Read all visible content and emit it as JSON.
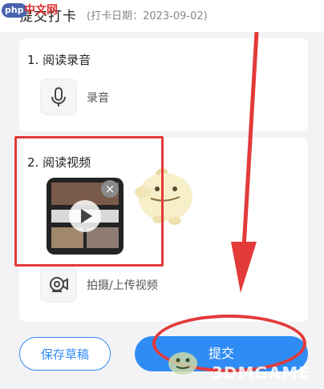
{
  "header": {
    "title": "提交打卡",
    "date_text": "(打卡日期：2023-09-02)"
  },
  "site_watermark": {
    "badge": "php",
    "cn_text": "中文网"
  },
  "audio_section": {
    "title": "1. 阅读录音",
    "action_label": "录音",
    "icon": "microphone-icon"
  },
  "video_section": {
    "title": "2. 阅读视频",
    "close_symbol": "×",
    "upload_label": "拍摄/上传视频",
    "upload_icon": "video-camera-icon"
  },
  "buttons": {
    "save_draft": "保存草稿",
    "submit": "提交"
  },
  "footer_watermark": {
    "text": "3DMGAME"
  },
  "colors": {
    "accent": "#2f8cf5",
    "annotation_red": "#e33a3a",
    "background": "#f3f3f5"
  }
}
